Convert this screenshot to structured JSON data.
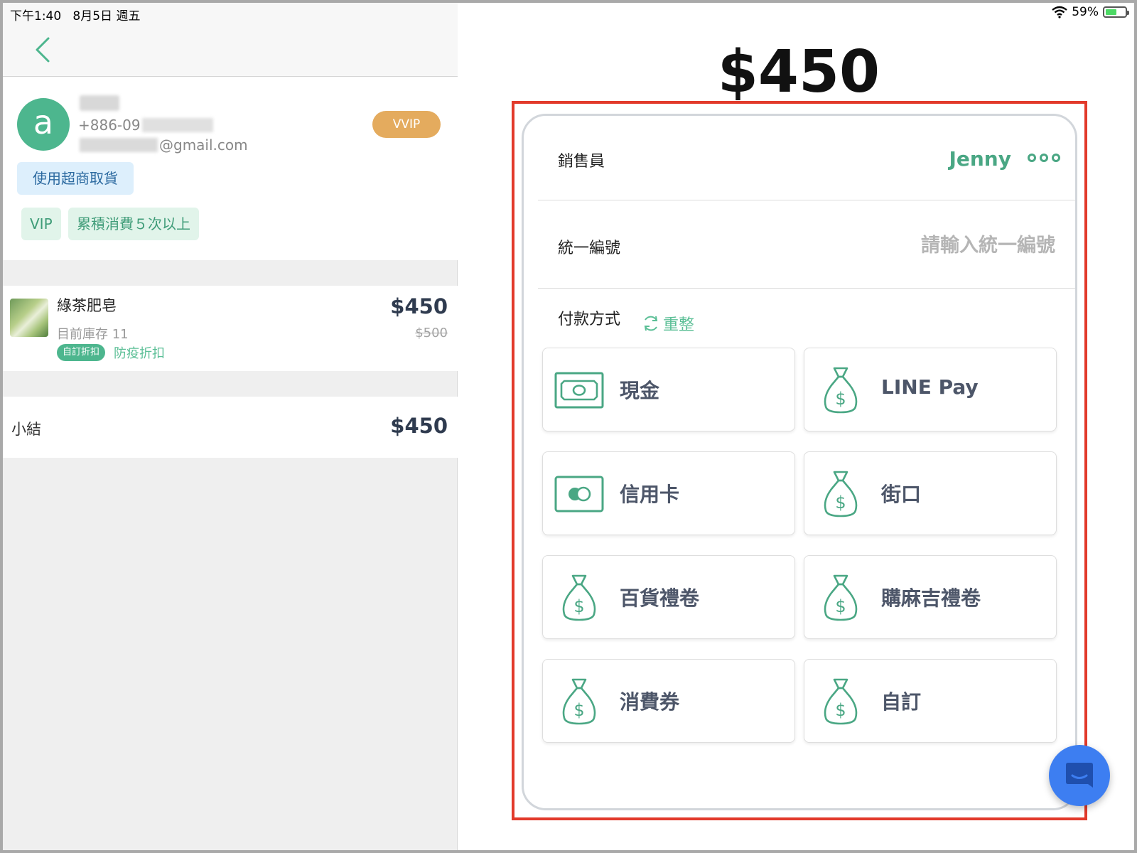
{
  "status_bar": {
    "time": "下午1:40",
    "date": "8月5日 週五",
    "battery": "59%",
    "battery_level": 0.59
  },
  "customer": {
    "avatar_letter": "a",
    "phone_prefix": "+886-09",
    "email_suffix": "@gmail.com",
    "level_badge": "VVIP",
    "pickup_tag": "使用超商取貨",
    "tags": [
      "VIP",
      "累積消費５次以上"
    ]
  },
  "cart": {
    "items": [
      {
        "name": "綠茶肥皂",
        "stock_label": "目前庫存 11",
        "discount_badge": "自訂折扣",
        "discount_name": "防疫折扣",
        "price": "$450",
        "original_price": "$500"
      }
    ],
    "subtotal_label": "小結",
    "subtotal_value": "$450"
  },
  "payment": {
    "total": "$450",
    "staff_label": "銷售員",
    "staff_name": "Jenny",
    "tax_id_label": "統一編號",
    "tax_id_placeholder": "請輸入統一編號",
    "method_label": "付款方式",
    "reset_label": "重整",
    "methods": [
      {
        "label": "現金",
        "icon": "cash-icon"
      },
      {
        "label": "LINE Pay",
        "icon": "money-bag-icon"
      },
      {
        "label": "信用卡",
        "icon": "credit-card-icon"
      },
      {
        "label": "街口",
        "icon": "money-bag-icon"
      },
      {
        "label": "百貨禮卷",
        "icon": "money-bag-icon"
      },
      {
        "label": "購麻吉禮卷",
        "icon": "money-bag-icon"
      },
      {
        "label": "消費券",
        "icon": "money-bag-icon"
      },
      {
        "label": "自訂",
        "icon": "money-bag-icon"
      }
    ]
  },
  "colors": {
    "accent_green": "#4db68e",
    "vvip_gold": "#e4ab5e",
    "highlight_red": "#e23a2b",
    "chat_blue": "#3d7ef1"
  }
}
